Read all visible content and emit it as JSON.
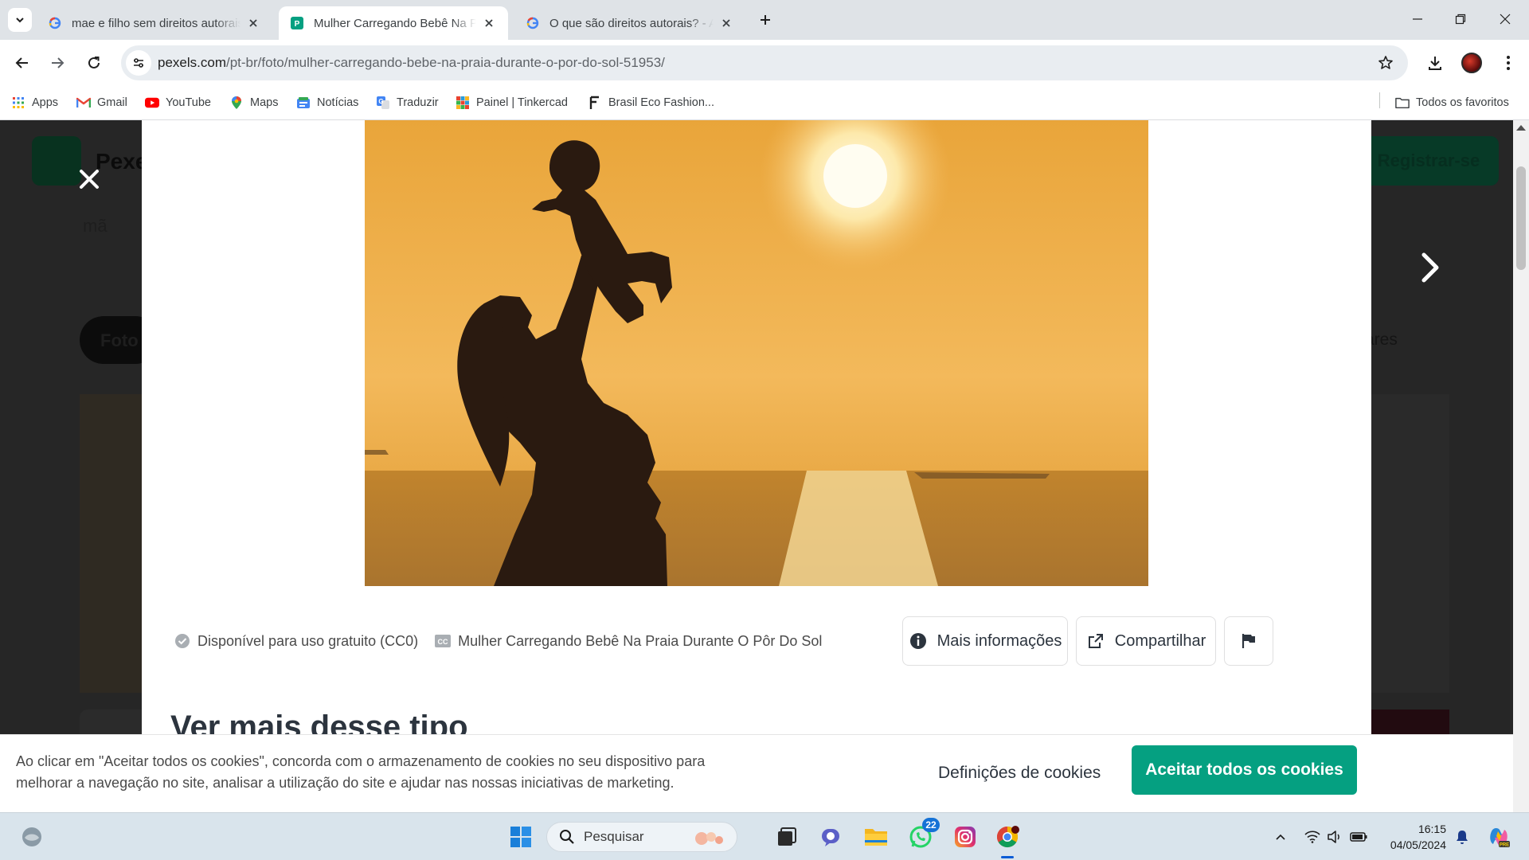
{
  "browser": {
    "tabs": [
      {
        "title": "mae e filho sem direitos autorais",
        "favicon": "google-icon",
        "active": false
      },
      {
        "title": "Mulher Carregando Bebê Na Praia Durante O Pôr Do Sol",
        "favicon": "pexels-icon",
        "active": true
      },
      {
        "title": "O que são direitos autorais? - Agência",
        "favicon": "google-icon",
        "active": false
      }
    ],
    "url_host": "pexels.com",
    "url_path": "/pt-br/foto/mulher-carregando-bebe-na-praia-durante-o-por-do-sol-51953/",
    "bookmarks": [
      {
        "label": "Apps",
        "icon": "apps-grid-icon"
      },
      {
        "label": "Gmail",
        "icon": "gmail-icon"
      },
      {
        "label": "YouTube",
        "icon": "youtube-icon"
      },
      {
        "label": "Maps",
        "icon": "maps-pin-icon"
      },
      {
        "label": "Notícias",
        "icon": "news-icon"
      },
      {
        "label": "Traduzir",
        "icon": "translate-icon"
      },
      {
        "label": "Painel | Tinkercad",
        "icon": "tinkercad-icon"
      },
      {
        "label": "Brasil Eco Fashion...",
        "icon": "fashion-icon"
      }
    ],
    "all_bookmarks": "Todos os favoritos"
  },
  "page_bg": {
    "logo_text": "Pexe",
    "register": "Registrar-se",
    "search_partial": "mã",
    "pill_partial": "Foto",
    "similar_partial": "ares"
  },
  "modal": {
    "license": "Disponível para uso gratuito (CC0)",
    "photo_title": "Mulher Carregando Bebê Na Praia Durante O Pôr Do Sol",
    "more_info": "Mais informações",
    "share": "Compartilhar",
    "more_heading": "Ver mais desse tipo"
  },
  "cookie": {
    "text": "Ao clicar em \"Aceitar todos os cookies\", concorda com o armazenamento de cookies no seu dispositivo para melhorar a navegação no site, analisar a utilização do site e ajudar nas nossas iniciativas de marketing.",
    "settings": "Definições de cookies",
    "accept": "Aceitar todos os cookies"
  },
  "taskbar": {
    "search_placeholder": "Pesquisar",
    "whatsapp_badge": "22",
    "time": "16:15",
    "date": "04/05/2024"
  },
  "colors": {
    "accent": "#05a081",
    "tab_strip": "#dfe3e7",
    "taskbar": "#d9e4ec"
  }
}
